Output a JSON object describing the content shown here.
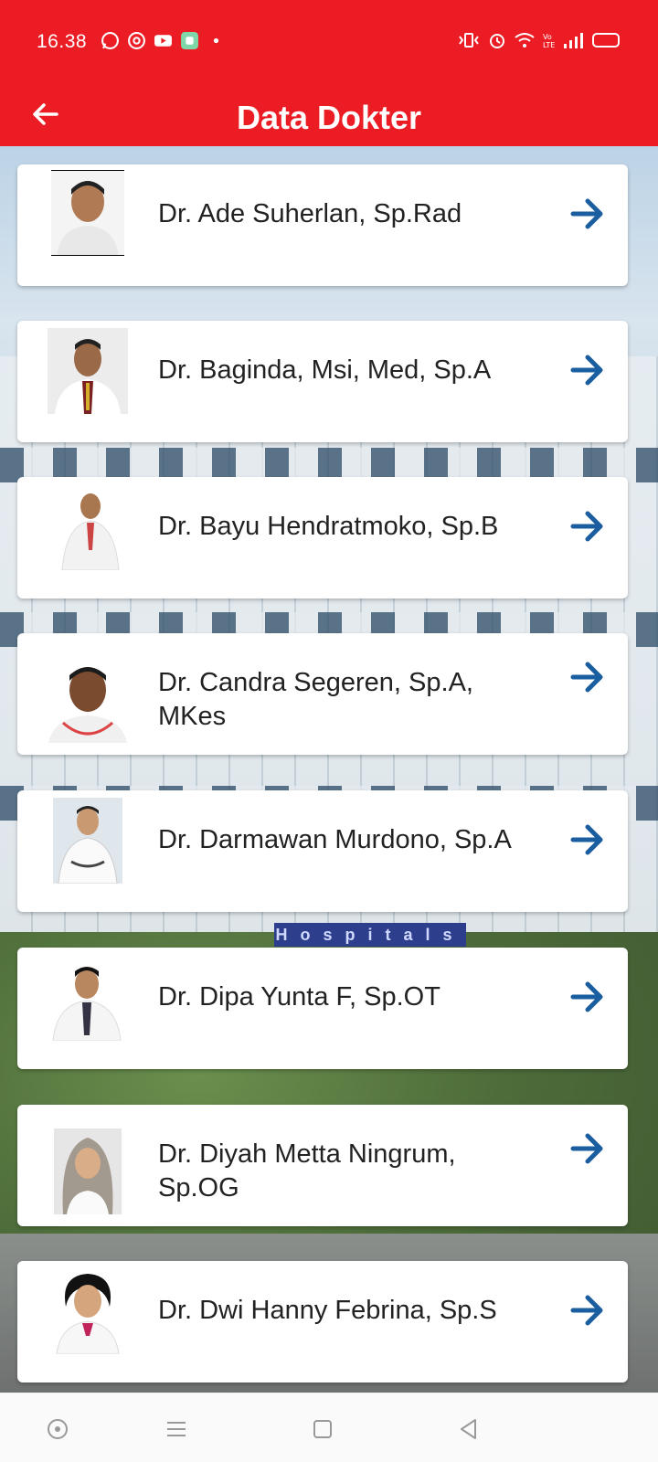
{
  "status_bar": {
    "time": "16.38"
  },
  "app_bar": {
    "title": "Data Dokter"
  },
  "background": {
    "sign_text": "Hospitals"
  },
  "colors": {
    "brand_red": "#ec1c24",
    "arrow_blue": "#1a5ea0"
  },
  "doctors": [
    {
      "name": "Dr. Ade Suherlan, Sp.Rad"
    },
    {
      "name": "Dr. Baginda, Msi, Med, Sp.A"
    },
    {
      "name": "Dr. Bayu Hendratmoko, Sp.B"
    },
    {
      "name": "Dr. Candra Segeren, Sp.A, MKes"
    },
    {
      "name": "Dr. Darmawan Murdono, Sp.A"
    },
    {
      "name": "Dr. Dipa Yunta F, Sp.OT"
    },
    {
      "name": "Dr. Diyah Metta Ningrum, Sp.OG"
    },
    {
      "name": "Dr. Dwi Hanny Febrina, Sp.S"
    }
  ],
  "icons": {
    "back": "arrow-left-icon",
    "row_action": "arrow-right-icon",
    "nav": [
      "circle-dot-icon",
      "menu-icon",
      "square-icon",
      "triangle-back-icon"
    ]
  }
}
